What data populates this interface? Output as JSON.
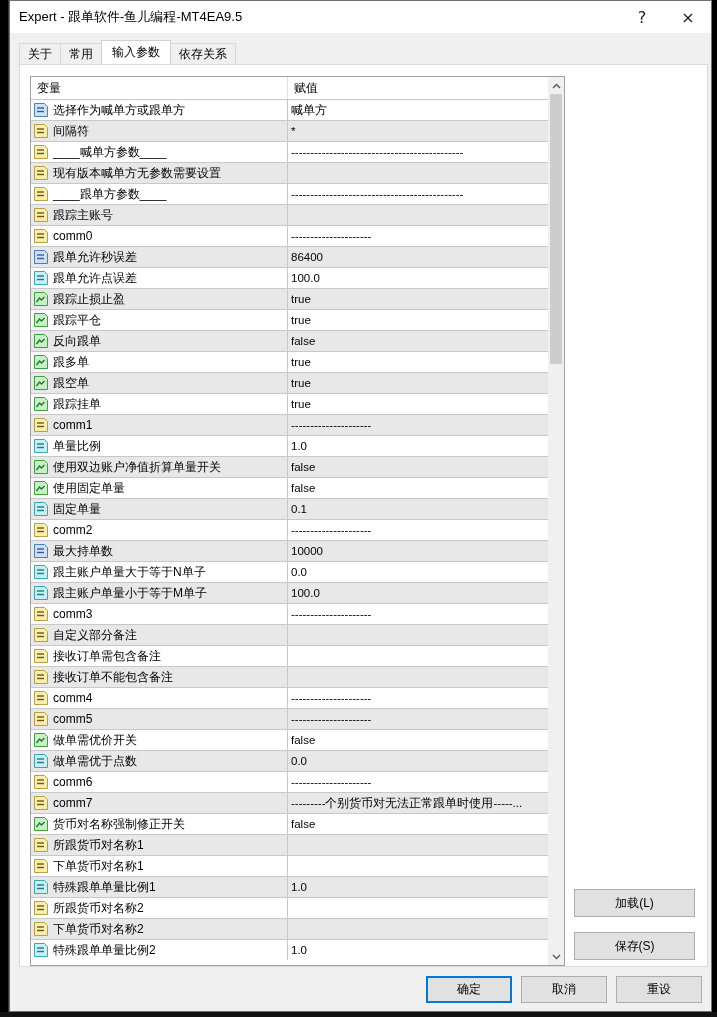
{
  "window": {
    "title": "Expert - 跟单软件-鱼儿编程-MT4EA9.5",
    "help_button": "?",
    "close_button": "×"
  },
  "tabs": [
    {
      "label": "关于",
      "selected": false
    },
    {
      "label": "常用",
      "selected": false
    },
    {
      "label": "输入参数",
      "selected": true
    },
    {
      "label": "依存关系",
      "selected": false
    }
  ],
  "table": {
    "columns": [
      "变量",
      "赋值"
    ],
    "rows": [
      {
        "kind": "int",
        "name": "选择作为喊单方或跟单方",
        "value": "喊单方"
      },
      {
        "kind": "str",
        "name": "间隔符",
        "value": "*"
      },
      {
        "kind": "str",
        "name": "____喊单方参数____",
        "value": "---------------------------------------------"
      },
      {
        "kind": "str",
        "name": "现有版本喊单方无参数需要设置"
      },
      {
        "kind": "str",
        "name": "____跟单方参数____",
        "value": "---------------------------------------------"
      },
      {
        "kind": "str",
        "name": "跟踪主账号"
      },
      {
        "kind": "str",
        "name": "comm0",
        "value": "---------------------"
      },
      {
        "kind": "int",
        "name": "跟单允许秒误差",
        "value": "86400"
      },
      {
        "kind": "double",
        "name": "跟单允许点误差",
        "value": "100.0"
      },
      {
        "kind": "bool",
        "name": "跟踪止损止盈",
        "value": "true"
      },
      {
        "kind": "bool",
        "name": "跟踪平仓",
        "value": "true"
      },
      {
        "kind": "bool",
        "name": "反向跟单",
        "value": "false"
      },
      {
        "kind": "bool",
        "name": "跟多单",
        "value": "true"
      },
      {
        "kind": "bool",
        "name": "跟空单",
        "value": "true"
      },
      {
        "kind": "bool",
        "name": "跟踪挂单",
        "value": "true"
      },
      {
        "kind": "str",
        "name": "comm1",
        "value": "---------------------"
      },
      {
        "kind": "double",
        "name": "单量比例",
        "value": "1.0"
      },
      {
        "kind": "bool",
        "name": "使用双边账户净值折算单量开关",
        "value": "false"
      },
      {
        "kind": "bool",
        "name": "使用固定单量",
        "value": "false"
      },
      {
        "kind": "double",
        "name": "固定单量",
        "value": "0.1"
      },
      {
        "kind": "str",
        "name": "comm2",
        "value": "---------------------"
      },
      {
        "kind": "int",
        "name": "最大持单数",
        "value": "10000"
      },
      {
        "kind": "double",
        "name": "跟主账户单量大于等于N单子",
        "value": "0.0"
      },
      {
        "kind": "double",
        "name": "跟主账户单量小于等于M单子",
        "value": "100.0"
      },
      {
        "kind": "str",
        "name": "comm3",
        "value": "---------------------"
      },
      {
        "kind": "str",
        "name": "自定义部分备注"
      },
      {
        "kind": "str",
        "name": "接收订单需包含备注"
      },
      {
        "kind": "str",
        "name": "接收订单不能包含备注"
      },
      {
        "kind": "str",
        "name": "comm4",
        "value": "---------------------"
      },
      {
        "kind": "str",
        "name": "comm5",
        "value": "---------------------"
      },
      {
        "kind": "bool",
        "name": "做单需优价开关",
        "value": "false"
      },
      {
        "kind": "double",
        "name": "做单需优于点数",
        "value": "0.0"
      },
      {
        "kind": "str",
        "name": "comm6",
        "value": "---------------------"
      },
      {
        "kind": "str",
        "name": "comm7",
        "value": "---------个别货币对无法正常跟单时使用-----..."
      },
      {
        "kind": "bool",
        "name": "货币对名称强制修正开关",
        "value": "false"
      },
      {
        "kind": "str",
        "name": "所跟货币对名称1"
      },
      {
        "kind": "str",
        "name": "下单货币对名称1"
      },
      {
        "kind": "double",
        "name": "特殊跟单单量比例1",
        "value": "1.0"
      },
      {
        "kind": "str",
        "name": "所跟货币对名称2"
      },
      {
        "kind": "str",
        "name": "下单货币对名称2"
      },
      {
        "kind": "double",
        "name": "特殊跟单单量比例2",
        "value": "1.0"
      }
    ]
  },
  "side_buttons": [
    "加载(L)",
    "保存(S)"
  ],
  "buttons": [
    {
      "label": "确定",
      "focused": true
    },
    {
      "label": "取消",
      "focused": false
    },
    {
      "label": "重设",
      "focused": false
    }
  ]
}
